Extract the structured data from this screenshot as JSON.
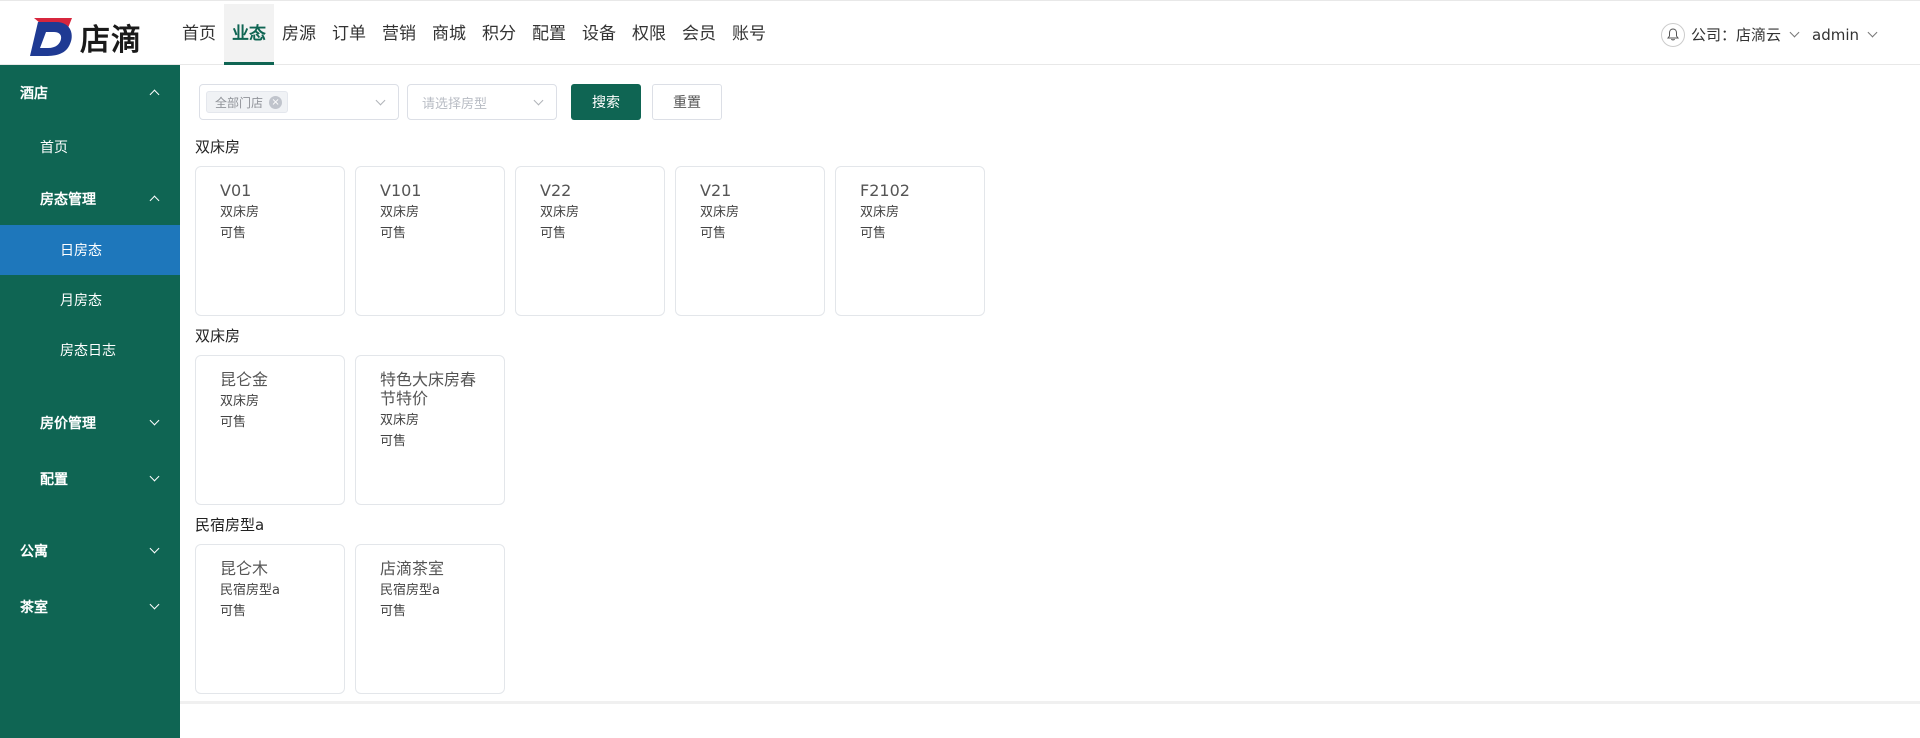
{
  "brand": {
    "logo_text": "店滴",
    "colors": {
      "primary": "#0f6553",
      "sidebar_active": "#1e77bb"
    }
  },
  "header": {
    "nav": [
      "首页",
      "业态",
      "房源",
      "订单",
      "营销",
      "商城",
      "积分",
      "配置",
      "设备",
      "权限",
      "会员",
      "账号"
    ],
    "active_nav": "业态",
    "company_label": "公司：店滴云",
    "user": "admin"
  },
  "sidebar": {
    "sections": [
      {
        "label": "酒店",
        "icon": "chevron-up-icon"
      },
      {
        "label": "首页"
      },
      {
        "label": "房态管理",
        "icon": "chevron-up-icon"
      },
      {
        "label": "日房态",
        "active": true
      },
      {
        "label": "月房态"
      },
      {
        "label": "房态日志"
      },
      {
        "label": "房价管理",
        "icon": "chevron-down-icon"
      },
      {
        "label": "配置",
        "icon": "chevron-down-icon"
      },
      {
        "label": "公寓",
        "icon": "chevron-down-icon"
      },
      {
        "label": "茶室",
        "icon": "chevron-down-icon"
      }
    ]
  },
  "filters": {
    "store_tag": "全部门店",
    "room_type_placeholder": "请选择房型",
    "search_label": "搜索",
    "reset_label": "重置"
  },
  "groups": [
    {
      "title": "双床房",
      "rooms": [
        {
          "name": "V01",
          "type": "双床房",
          "status": "可售"
        },
        {
          "name": "V101",
          "type": "双床房",
          "status": "可售"
        },
        {
          "name": "V22",
          "type": "双床房",
          "status": "可售"
        },
        {
          "name": "V21",
          "type": "双床房",
          "status": "可售"
        },
        {
          "name": "F2102",
          "type": "双床房",
          "status": "可售"
        }
      ]
    },
    {
      "title": "双床房",
      "rooms": [
        {
          "name": "昆仑金",
          "type": "双床房",
          "status": "可售"
        },
        {
          "name": "特色大床房春节特价",
          "type": "双床房",
          "status": "可售"
        }
      ]
    },
    {
      "title": "民宿房型a",
      "rooms": [
        {
          "name": "昆仑木",
          "type": "民宿房型a",
          "status": "可售"
        },
        {
          "name": "店滴茶室",
          "type": "民宿房型a",
          "status": "可售"
        }
      ]
    }
  ]
}
